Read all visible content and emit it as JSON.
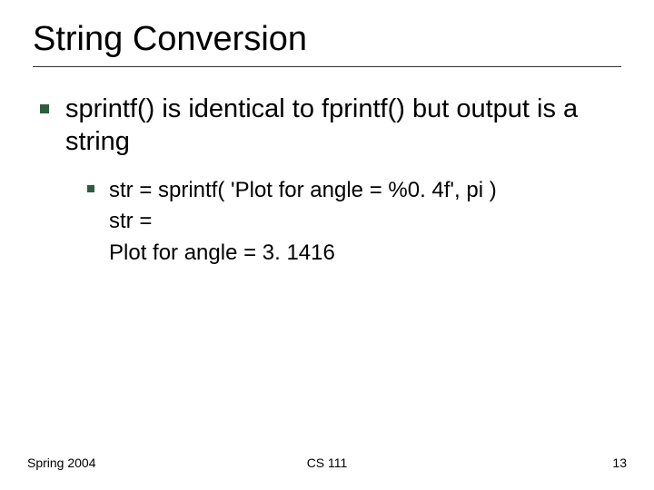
{
  "title": "String Conversion",
  "point_main": "sprintf() is identical to fprintf() but output is a string",
  "sub_code": "str = sprintf( 'Plot for angle = %0. 4f', pi )",
  "output_line1": "str =",
  "output_line2": "Plot for angle = 3. 1416",
  "footer": {
    "left": "Spring 2004",
    "center": "CS 111",
    "page": "13"
  }
}
